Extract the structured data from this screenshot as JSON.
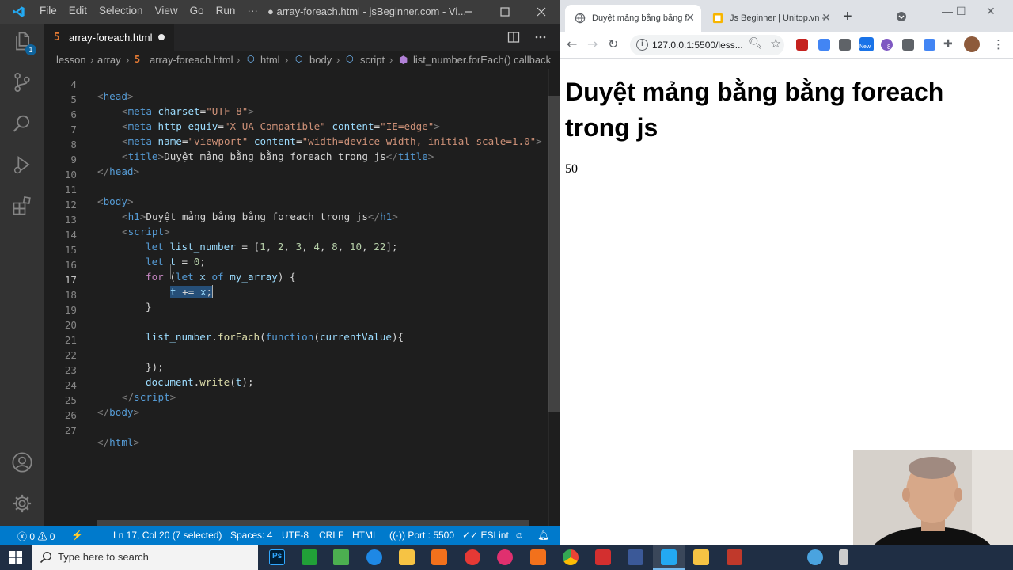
{
  "vscode": {
    "menu": [
      "File",
      "Edit",
      "Selection",
      "View",
      "Go",
      "Run",
      "···"
    ],
    "window_title": "● array-foreach.html - jsBeginner.com - Vi...",
    "explorer_badge": "1",
    "tab": {
      "label": "array-foreach.html"
    },
    "breadcrumb": [
      "lesson",
      "array",
      "array-foreach.html",
      "html",
      "body",
      "script",
      "list_number.forEach() callback"
    ],
    "line_numbers": [
      "4",
      "5",
      "6",
      "7",
      "8",
      "9",
      "10",
      "11",
      "12",
      "13",
      "14",
      "15",
      "16",
      "17",
      "18",
      "19",
      "20",
      "21",
      "22",
      "23",
      "24",
      "25",
      "26",
      "27"
    ],
    "code": {
      "l4": [
        "<",
        "head",
        ">"
      ],
      "l5": [
        "<",
        "meta",
        " ",
        "charset",
        "=",
        "\"UTF-8\"",
        ">"
      ],
      "l6": [
        "<",
        "meta",
        " ",
        "http-equiv",
        "=",
        "\"X-UA-Compatible\"",
        " ",
        "content",
        "=",
        "\"IE=edge\"",
        ">"
      ],
      "l7": [
        "<",
        "meta",
        " ",
        "name",
        "=",
        "\"viewport\"",
        " ",
        "content",
        "=",
        "\"width=device-width, initial-scale=1.0\"",
        ">"
      ],
      "l8": [
        "<",
        "title",
        ">",
        "Duyệt mảng bằng bằng foreach trong js",
        "</",
        "title",
        ">"
      ],
      "l9": [
        "</",
        "head",
        ">"
      ],
      "l11": [
        "<",
        "body",
        ">"
      ],
      "l12": [
        "<",
        "h1",
        ">",
        "Duyệt mảng bằng bằng foreach trong js",
        "</",
        "h1",
        ">"
      ],
      "l13": [
        "<",
        "script",
        ">"
      ],
      "l14": [
        "let",
        " ",
        "list_number",
        " = [",
        "1",
        ", ",
        "2",
        ", ",
        "3",
        ", ",
        "4",
        ", ",
        "8",
        ", ",
        "10",
        ", ",
        "22",
        "];"
      ],
      "l15": [
        "let",
        " ",
        "t",
        " = ",
        "0",
        ";"
      ],
      "l16": [
        "for",
        " (",
        "let",
        " ",
        "x",
        " ",
        "of",
        " ",
        "my_array",
        ") {"
      ],
      "l17": [
        "t",
        " += ",
        "x",
        ";"
      ],
      "l18": [
        "}"
      ],
      "l20": [
        "list_number",
        ".",
        "forEach",
        "(",
        "function",
        "(",
        "currentValue",
        "){"
      ],
      "l22": [
        "});"
      ],
      "l23": [
        "document",
        ".",
        "write",
        "(",
        "t",
        ");"
      ],
      "l24": [
        "</",
        "script",
        ">"
      ],
      "l25": [
        "</",
        "body",
        ">"
      ],
      "l27": [
        "</",
        "html",
        ">"
      ]
    },
    "status": {
      "errors": "0",
      "warnings": "0",
      "position": "Ln 17, Col 20 (7 selected)",
      "spaces": "Spaces: 4",
      "encoding": "UTF-8",
      "eol": "CRLF",
      "language": "HTML",
      "port": "Port : 5500",
      "eslint": "ESLint"
    }
  },
  "chrome": {
    "tabs": [
      {
        "title": "Duyệt mảng bằng bằng fo"
      },
      {
        "title": "Js Beginner | Unitop.vn - G"
      }
    ],
    "url": "127.0.0.1:5500/less...",
    "ext_new_label": "New",
    "ext_count": "8",
    "page": {
      "heading": "Duyệt mảng bằng bằng foreach trong js",
      "output": "50"
    }
  },
  "taskbar": {
    "search_placeholder": "Type here to search"
  },
  "colors": {
    "vscode_bg": "#1e1e1e",
    "statusbar": "#007acc",
    "selection": "#264f78",
    "taskbar": "#1f2e44"
  }
}
